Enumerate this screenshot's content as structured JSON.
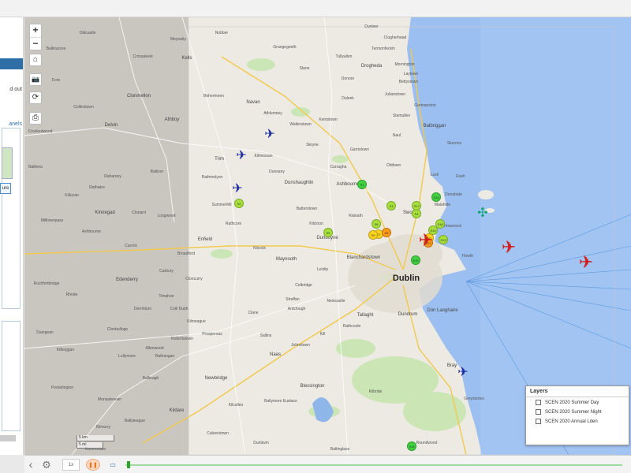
{
  "left_panel": {
    "fragments": [
      "d out",
      "anels",
      "ure"
    ]
  },
  "map": {
    "controls": {
      "zoom_in": "+",
      "zoom_out": "−",
      "home_icon": "⌂",
      "camera_icon": "📷",
      "refresh_icon": "⟳",
      "print_icon": "⎙"
    },
    "places": {
      "dublin": "Dublin",
      "navan": "Navan",
      "trim": "Trim",
      "drogheda": "Drogheda",
      "balbriggan": "Balbriggan",
      "skerries": "Skerries",
      "rush": "Rush",
      "lusk": "Lusk",
      "ashbourne": "Ashbourne",
      "swords": "Swords",
      "malahide": "Malahide",
      "howth": "Howth",
      "dunboyne": "Dunboyne",
      "maynooth": "Maynooth",
      "leixlip": "Leixlip",
      "celbridge": "Celbridge",
      "clane": "Clane",
      "naas": "Naas",
      "kilcock": "Kilcock",
      "enfield": "Enfield",
      "kinnegad": "Kinnegad",
      "edenderry": "Edenderry",
      "athboy": "Athboy",
      "delvin": "Delvin",
      "clonmellon": "Clonmellon",
      "kells": "Kells",
      "oldcastle": "Oldcastle",
      "slane": "Slane",
      "duleek": "Duleek",
      "julianstown": "Julianstown",
      "stamullen": "Stamullen",
      "tallaght": "Tallaght",
      "dundrum": "Dundrum",
      "dun_laoghaire": "Dún Laoghaire",
      "bray": "Bray",
      "greystones": "Greystones",
      "blessington": "Blessington",
      "kilcullen": "Kilcullen",
      "newbridge": "Newbridge",
      "kildare": "Kildare",
      "monasterevin": "Monasterevin",
      "portarlington": "Portarlington",
      "ballymore_eustace": "Ballymore Eustace",
      "blanchardstown": "Blanchardstown",
      "dunshaughlin": "Dunshaughlin",
      "ratoath": "Ratoath",
      "summerhill": "Summerhill",
      "rathmolyon": "Rathmolyon",
      "kilmessan": "Kilmessan",
      "walterstown": "Walterstown",
      "garristown": "Garristown",
      "curragha": "Curragha",
      "clonard": "Clonard",
      "longwood": "Longwood",
      "carbury": "Carbury",
      "prosperous": "Prosperous",
      "sallins": "Sallins",
      "johnstown": "Johnstown",
      "kill": "Kill",
      "newcastle": "Newcastle",
      "rathangan": "Rathangan",
      "baltinglass": "Baltinglass",
      "roundwood": "Roundwood",
      "calverstown": "Calverstown",
      "ardclough": "Ardclough",
      "straffan": "Straffan",
      "dunlavin": "Dunlavin",
      "ballinagh": "Ballinagh",
      "rathcoole": "Rathcoole",
      "kilbride": "Kilbride",
      "laytown": "Laytown",
      "bettystown": "Bettystown",
      "mornington": "Mornington",
      "gormanston": "Gormanston",
      "naul": "Naul",
      "oldtown": "Oldtown",
      "donabate": "Donabate",
      "portmarnock": "Portmarnock",
      "kilbeggan": "Kilbeggan",
      "milltownpass": "Milltownpass",
      "rochfortbridge": "Rochfortbridge",
      "ballinea": "Ballinea",
      "collinstown": "Collinstown",
      "fore": "Fore",
      "crossakeel": "Crossakeel",
      "ballivor": "Ballivor",
      "raharney": "Raharney",
      "rathwire": "Rathwire",
      "killucan": "Killucan",
      "daingean": "Daingean",
      "rhode": "Rhode",
      "clonbulloge": "Clonbulloge",
      "allenwood": "Allenwood",
      "robertstown": "Robertstown",
      "kilmeague": "Kilmeague",
      "timahoe": "Timahoe",
      "coill_dubh": "Coill Dubh",
      "derrinturn": "Derrinturn",
      "cloncurry": "Cloncurry",
      "broadford": "Broadford",
      "nobber": "Nobber",
      "moynalty": "Moynalty",
      "ballinacree": "Ballinacree",
      "grangegeeth": "Grangegeeth",
      "dunleer": "Dunleer",
      "clogherhead": "Clogherhead",
      "termonfeckin": "Termonfeckin",
      "tullyallen": "Tullyallen",
      "donore": "Donore",
      "bohermeen": "Bohermeen",
      "athlumney": "Athlumney",
      "kentstown": "Kentstown",
      "ashbourne_x": "Ashbourne",
      "skryne": "Skryne",
      "dunsany": "Dunsany",
      "batterstown": "Batterstown",
      "kilcloon": "Kilcloon",
      "rathcore": "Rathcore",
      "carrick": "Carrick",
      "lullymore": "Lullymore",
      "ballyteague": "Ballyteague",
      "kilmurry": "Kilmurry",
      "crookedwood": "Crookedwood",
      "ravensdale": "Ravensdale"
    },
    "markers": [
      {
        "label": "S1",
        "color": "green"
      },
      {
        "label": "S2",
        "color": "lime"
      },
      {
        "label": "S3",
        "color": "lime"
      },
      {
        "label": "S4",
        "color": "lime"
      },
      {
        "label": "S5",
        "color": "lime"
      },
      {
        "label": "S6",
        "color": "lime"
      },
      {
        "label": "S7",
        "color": "yellow"
      },
      {
        "label": "S8",
        "color": "orange"
      },
      {
        "label": "S9",
        "color": "yellow"
      },
      {
        "label": "S10",
        "color": "lime"
      },
      {
        "label": "S11",
        "color": "yellow"
      },
      {
        "label": "S12",
        "color": "orange"
      },
      {
        "label": "S13",
        "color": "lime"
      },
      {
        "label": "S14",
        "color": "green"
      },
      {
        "label": "S15",
        "color": "green"
      },
      {
        "label": "S16",
        "color": "green"
      },
      {
        "label": "S17",
        "color": "lime"
      },
      {
        "label": "S18",
        "color": "lime"
      }
    ],
    "scale": {
      "large": "5 km",
      "small": "5 mi"
    }
  },
  "layers": {
    "title": "Layers",
    "items": [
      {
        "label": "SCEN 2020 Summer Day",
        "checked": false
      },
      {
        "label": "SCEN 2020 Summer Night",
        "checked": false
      },
      {
        "label": "SCEN 2020 Annual Lden",
        "checked": false
      }
    ]
  },
  "bottom_bar": {
    "chevron_icon": "‹",
    "gear_icon": "⚙",
    "speed_label": "1x",
    "pause_label": "❚❚",
    "monitor_icon": "▭"
  },
  "colors": {
    "sea": "#9bbff0",
    "land": "#eceae3",
    "shaded_land": "#c9c6c0",
    "park": "#c8e6b0",
    "accent": "#2f6fa8"
  }
}
